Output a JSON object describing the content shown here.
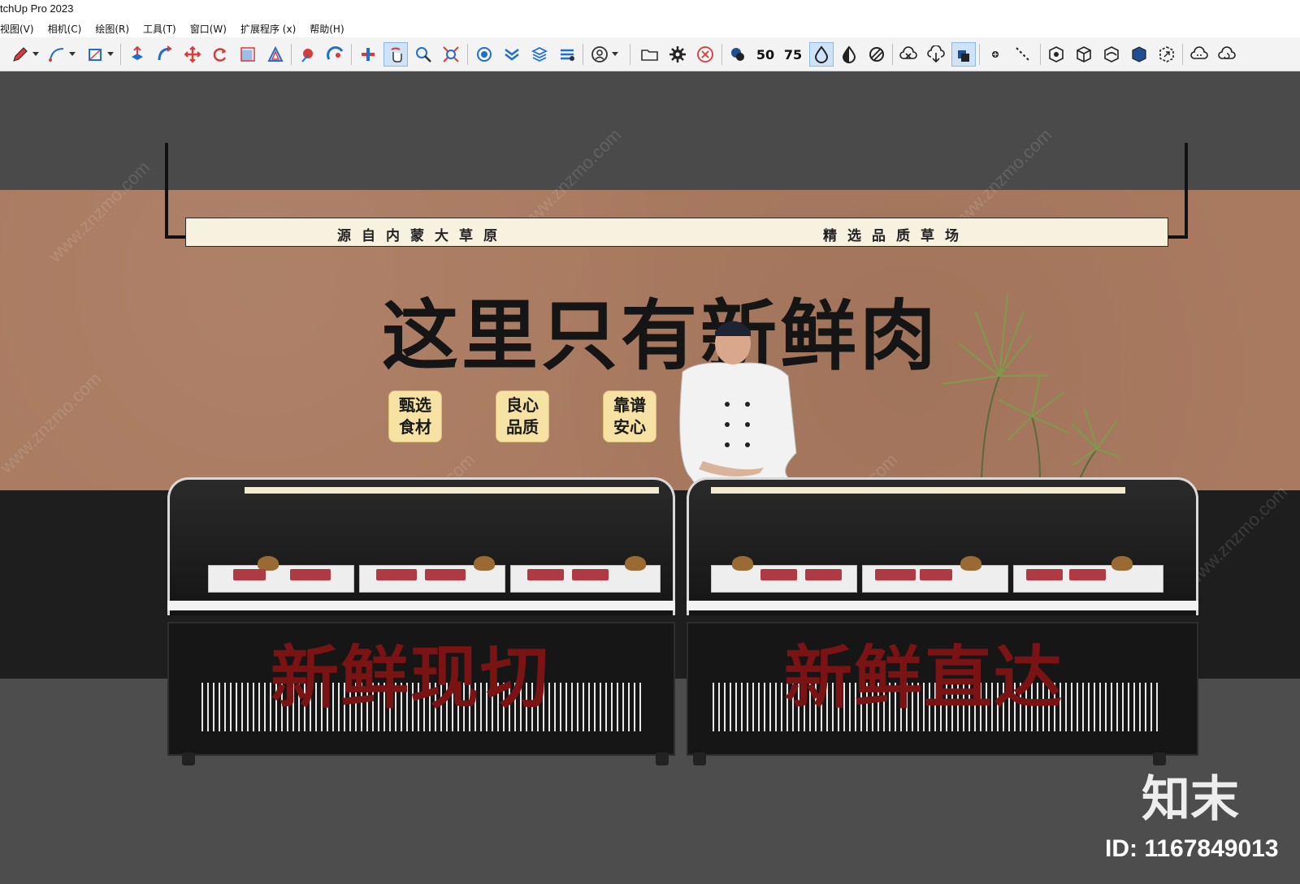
{
  "window": {
    "title": "tchUp Pro 2023"
  },
  "menu": [
    "视图(V)",
    "相机(C)",
    "绘图(R)",
    "工具(T)",
    "窗口(W)",
    "扩展程序 (x)",
    "帮助(H)"
  ],
  "toolbar": {
    "icons": [
      "pencil-icon",
      "arc-icon",
      "rectangle-icon",
      "push-pull-icon",
      "follow-me-icon",
      "move-icon",
      "rotate-icon",
      "scale-icon",
      "offset-icon",
      "tape-measure-icon",
      "protractor-icon",
      "section-plane-icon",
      "orbit-icon",
      "pan-icon",
      "zoom-icon",
      "zoom-extents-icon",
      "components-icon",
      "materials-icon",
      "layers-icon",
      "styles-icon",
      "account-icon",
      "open-folder-icon",
      "settings-icon",
      "cancel-icon",
      "layer-stack-icon",
      "stat-50-icon",
      "stat-75-icon",
      "drop-icon",
      "half-drop-icon",
      "striped-drop-icon",
      "cloud-x-icon",
      "cloud-download-icon",
      "cloud-stack-icon",
      "point-icon",
      "dashed-line-icon",
      "box-gear-icon",
      "box-outline-icon",
      "box-top-icon",
      "box-filled-icon",
      "box-arrow-icon",
      "cloud-sync-icon",
      "cloud-refresh-icon"
    ],
    "stat_50": "50",
    "stat_75": "75"
  },
  "scene": {
    "light_bar_left": "源自内蒙大草原",
    "light_bar_right": "精选品质草场",
    "headline": "这里只有新鲜肉",
    "badges": [
      {
        "line1": "甄选",
        "line2": "食材"
      },
      {
        "line1": "良心",
        "line2": "品质"
      },
      {
        "line1": "靠谱",
        "line2": "安心"
      }
    ],
    "counter_left_text": "新鲜现切",
    "counter_right_text": "新鲜直达"
  },
  "overlay": {
    "logo": "知末",
    "image_id": "ID: 1167849013",
    "watermark": "www.znzmo.com"
  },
  "colors": {
    "wall": "#a97a60",
    "dark_band": "#1e1e1e",
    "floor": "#4d4d4d",
    "badge": "#f6e2a3",
    "counter_text": "#7a1313",
    "light_bar": "#f7f1df"
  }
}
